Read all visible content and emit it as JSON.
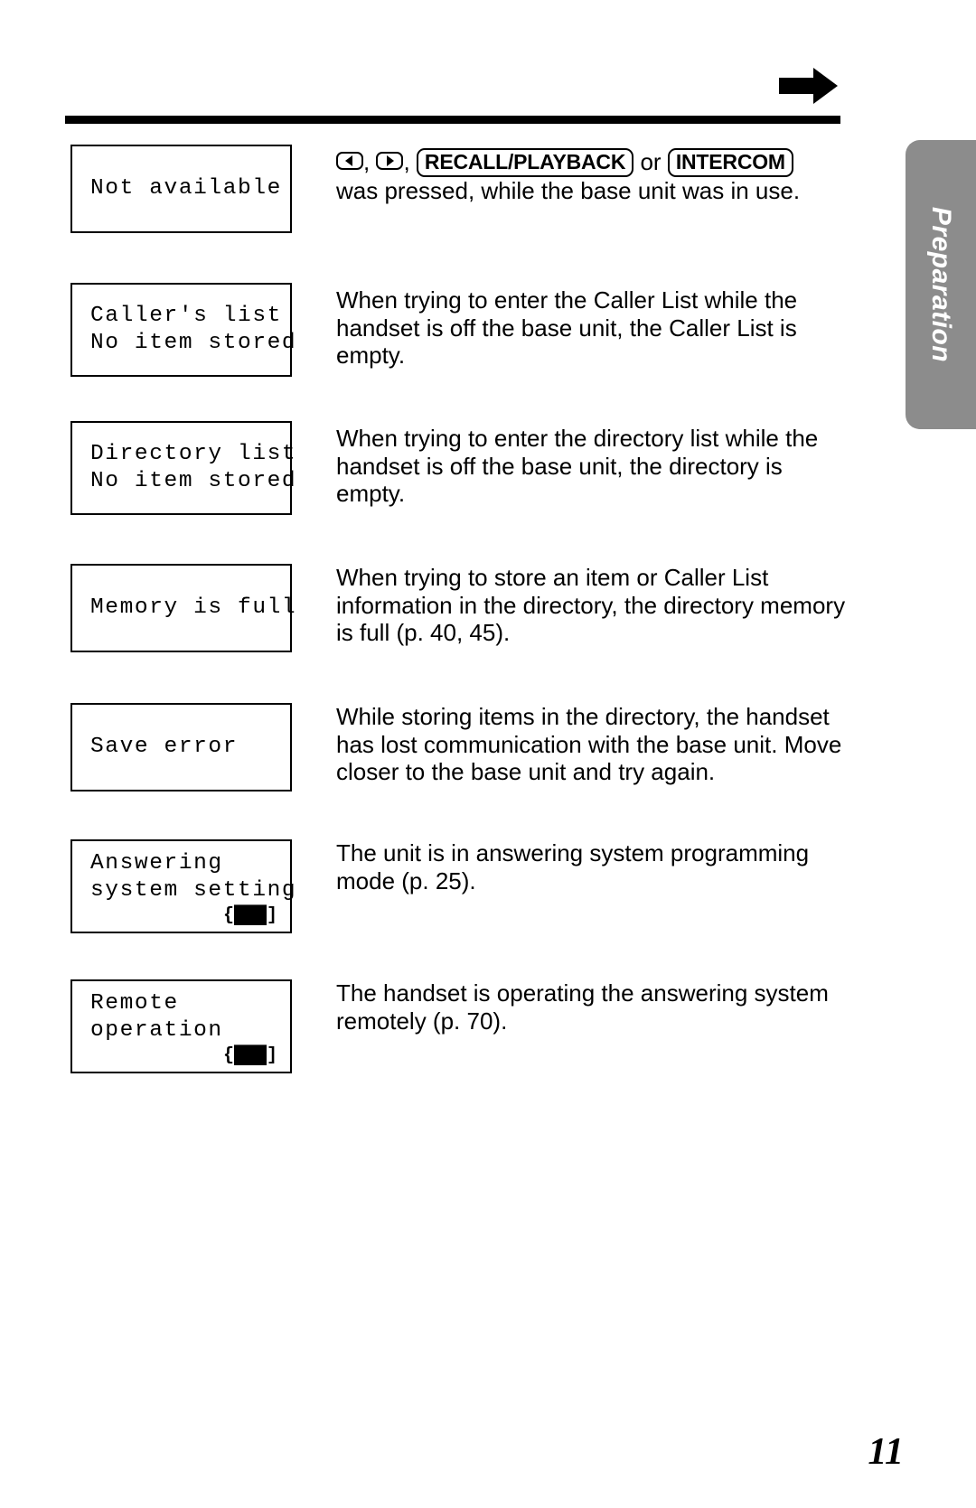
{
  "page": {
    "number": "11",
    "side_tab_label": "Preparation",
    "header_icon": "right-arrow-icon"
  },
  "entries": [
    {
      "id": "not-available",
      "lcd_lines": [
        "Not available"
      ],
      "battery": null,
      "description_parts": [
        {
          "type": "keycap-arrow",
          "direction": "left"
        },
        {
          "type": "text",
          "value": ", "
        },
        {
          "type": "keycap-arrow",
          "direction": "right"
        },
        {
          "type": "text",
          "value": ", "
        },
        {
          "type": "keycap",
          "value": "RECALL/PLAYBACK"
        },
        {
          "type": "text",
          "value": " or "
        },
        {
          "type": "keycap",
          "value": "INTERCOM"
        },
        {
          "type": "text",
          "value": " was pressed, while the base unit was in use."
        }
      ],
      "description_plain": "was pressed, while the base unit was in use."
    },
    {
      "id": "callers-list-empty",
      "lcd_lines": [
        "Caller's list",
        "No item stored"
      ],
      "battery": null,
      "description": "When trying to enter the Caller List while the handset is off the base unit, the Caller List is empty."
    },
    {
      "id": "directory-list-empty",
      "lcd_lines": [
        "Directory list",
        "No item stored"
      ],
      "battery": null,
      "description": "When trying to enter the directory list while the handset is off the base unit, the directory is empty."
    },
    {
      "id": "memory-is-full",
      "lcd_lines": [
        "Memory is full"
      ],
      "battery": null,
      "description": "When trying to store an item or Caller List information in the directory, the directory memory is full (p. 40, 45)."
    },
    {
      "id": "save-error",
      "lcd_lines": [
        "Save error"
      ],
      "battery": null,
      "description": "While storing items in the directory, the handset has lost communication with the base unit. Move closer to the base unit and try again."
    },
    {
      "id": "answering-system-setting",
      "lcd_lines": [
        "Answering",
        "system setting"
      ],
      "battery": "{███]",
      "description": "The unit is in answering system programming mode (p. 25)."
    },
    {
      "id": "remote-operation",
      "lcd_lines": [
        "Remote",
        "operation"
      ],
      "battery": "{███]",
      "description": "The handset is operating the answering system remotely (p. 70)."
    }
  ]
}
